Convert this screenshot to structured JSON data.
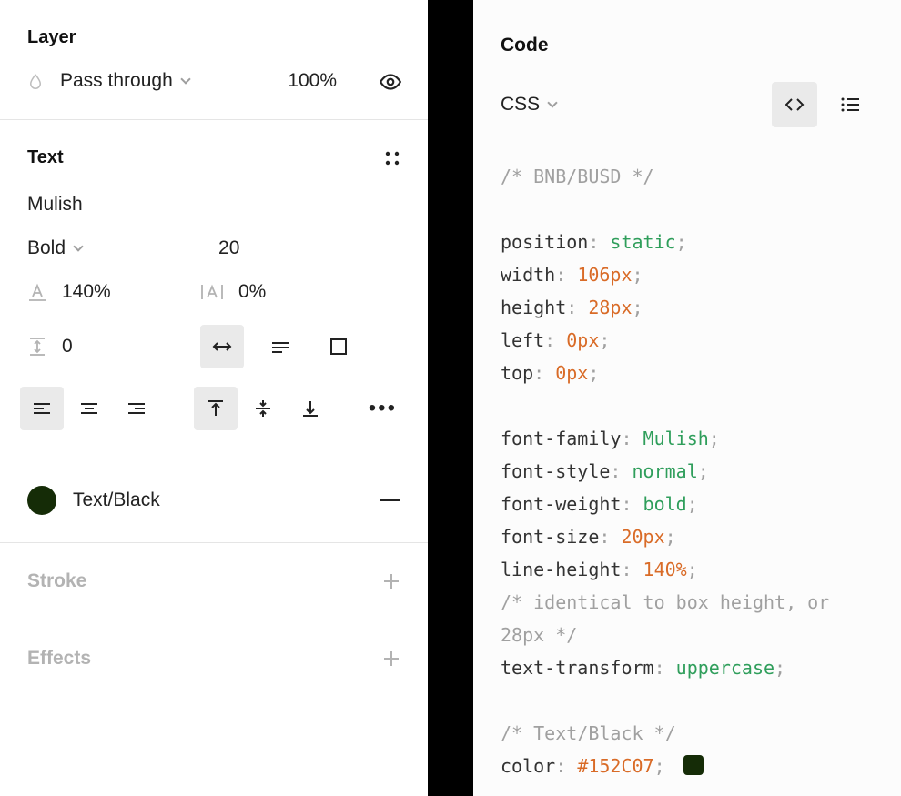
{
  "left": {
    "layer": {
      "title": "Layer",
      "blend_mode": "Pass through",
      "opacity": "100%"
    },
    "text": {
      "title": "Text",
      "font_family": "Mulish",
      "font_weight": "Bold",
      "font_size": "20",
      "line_height": "140%",
      "letter_spacing": "0%",
      "paragraph_spacing": "0"
    },
    "color": {
      "label": "Text/Black",
      "hex": "#152C07"
    },
    "stroke": {
      "title": "Stroke"
    },
    "effects": {
      "title": "Effects"
    }
  },
  "right": {
    "title": "Code",
    "language": "CSS",
    "css": {
      "comment_selector": "/* BNB/BUSD */",
      "position_prop": "position",
      "position_val": "static",
      "width_prop": "width",
      "width_val": "106px",
      "height_prop": "height",
      "height_val": "28px",
      "left_prop": "left",
      "left_val": "0px",
      "top_prop": "top",
      "top_val": "0px",
      "font_family_prop": "font-family",
      "font_family_val": "Mulish",
      "font_style_prop": "font-style",
      "font_style_val": "normal",
      "font_weight_prop": "font-weight",
      "font_weight_val": "bold",
      "font_size_prop": "font-size",
      "font_size_val": "20px",
      "line_height_prop": "line-height",
      "line_height_val": "140%",
      "comment_lineheight": "/* identical to box height, or 28px */",
      "text_transform_prop": "text-transform",
      "text_transform_val": "uppercase",
      "comment_color": "/* Text/Black */",
      "color_prop": "color",
      "color_val": "#152C07"
    }
  }
}
